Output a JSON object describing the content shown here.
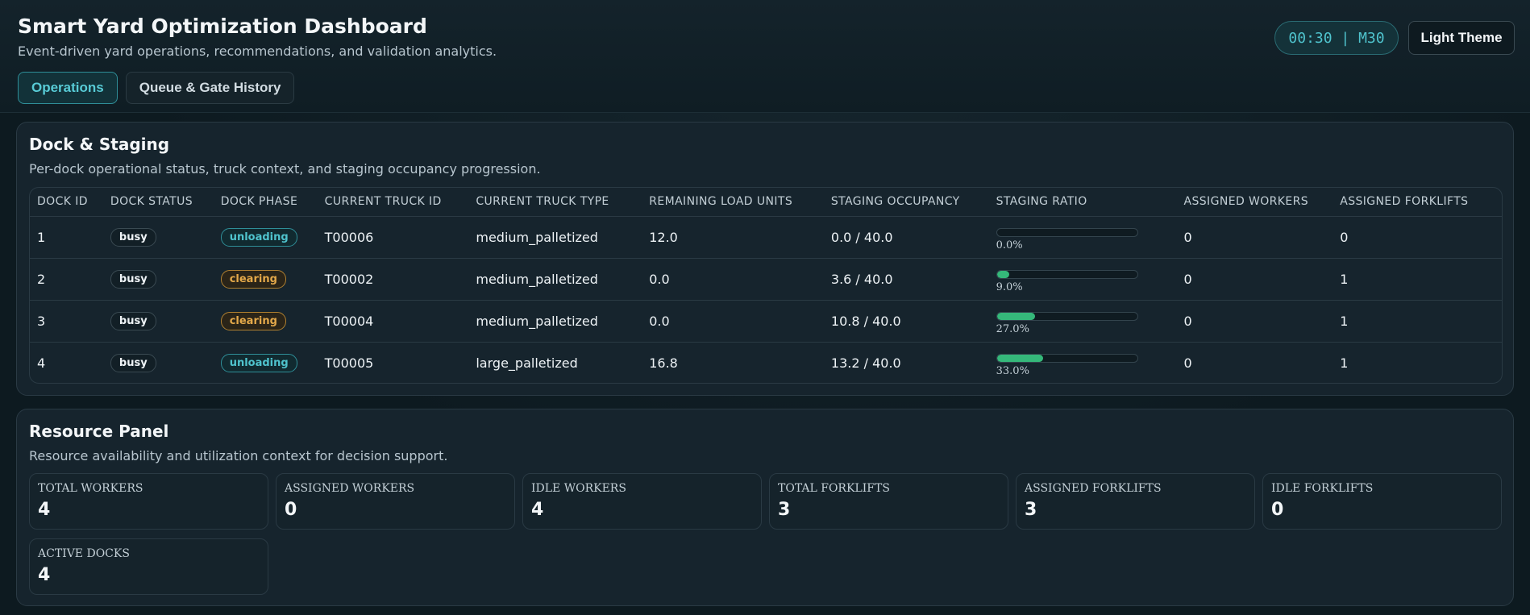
{
  "header": {
    "title": "Smart Yard Optimization Dashboard",
    "subtitle": "Event-driven yard operations, recommendations, and validation analytics.",
    "tabs": [
      {
        "label": "Operations",
        "active": true
      },
      {
        "label": "Queue & Gate History",
        "active": false
      }
    ],
    "clock": "00:30 | M30",
    "theme_button": "Light Theme"
  },
  "dock_panel": {
    "title": "Dock & Staging",
    "subtitle": "Per-dock operational status, truck context, and staging occupancy progression.",
    "columns": [
      "DOCK ID",
      "DOCK STATUS",
      "DOCK PHASE",
      "CURRENT TRUCK ID",
      "CURRENT TRUCK TYPE",
      "REMAINING LOAD UNITS",
      "STAGING OCCUPANCY",
      "STAGING RATIO",
      "ASSIGNED WORKERS",
      "ASSIGNED FORKLIFTS"
    ],
    "rows": [
      {
        "dock_id": "1",
        "status": "busy",
        "phase": "unloading",
        "truck_id": "T00006",
        "truck_type": "medium_palletized",
        "remaining": "12.0",
        "occupancy": "0.0 / 40.0",
        "ratio": 0.0,
        "ratio_label": "0.0%",
        "workers": "0",
        "forklifts": "0"
      },
      {
        "dock_id": "2",
        "status": "busy",
        "phase": "clearing",
        "truck_id": "T00002",
        "truck_type": "medium_palletized",
        "remaining": "0.0",
        "occupancy": "3.6 / 40.0",
        "ratio": 0.09,
        "ratio_label": "9.0%",
        "workers": "0",
        "forklifts": "1"
      },
      {
        "dock_id": "3",
        "status": "busy",
        "phase": "clearing",
        "truck_id": "T00004",
        "truck_type": "medium_palletized",
        "remaining": "0.0",
        "occupancy": "10.8 / 40.0",
        "ratio": 0.27,
        "ratio_label": "27.0%",
        "workers": "0",
        "forklifts": "1"
      },
      {
        "dock_id": "4",
        "status": "busy",
        "phase": "unloading",
        "truck_id": "T00005",
        "truck_type": "large_palletized",
        "remaining": "16.8",
        "occupancy": "13.2 / 40.0",
        "ratio": 0.33,
        "ratio_label": "33.0%",
        "workers": "0",
        "forklifts": "1"
      }
    ]
  },
  "resource_panel": {
    "title": "Resource Panel",
    "subtitle": "Resource availability and utilization context for decision support.",
    "cards": [
      {
        "label": "TOTAL WORKERS",
        "value": "4"
      },
      {
        "label": "ASSIGNED WORKERS",
        "value": "0"
      },
      {
        "label": "IDLE WORKERS",
        "value": "4"
      },
      {
        "label": "TOTAL FORKLIFTS",
        "value": "3"
      },
      {
        "label": "ASSIGNED FORKLIFTS",
        "value": "3"
      },
      {
        "label": "IDLE FORKLIFTS",
        "value": "0"
      },
      {
        "label": "ACTIVE DOCKS",
        "value": "4"
      }
    ]
  },
  "colors": {
    "accent": "#4fc3cd",
    "clearing": "#e4a94a",
    "progress": "#35b87a",
    "background": "#0d1a20"
  }
}
